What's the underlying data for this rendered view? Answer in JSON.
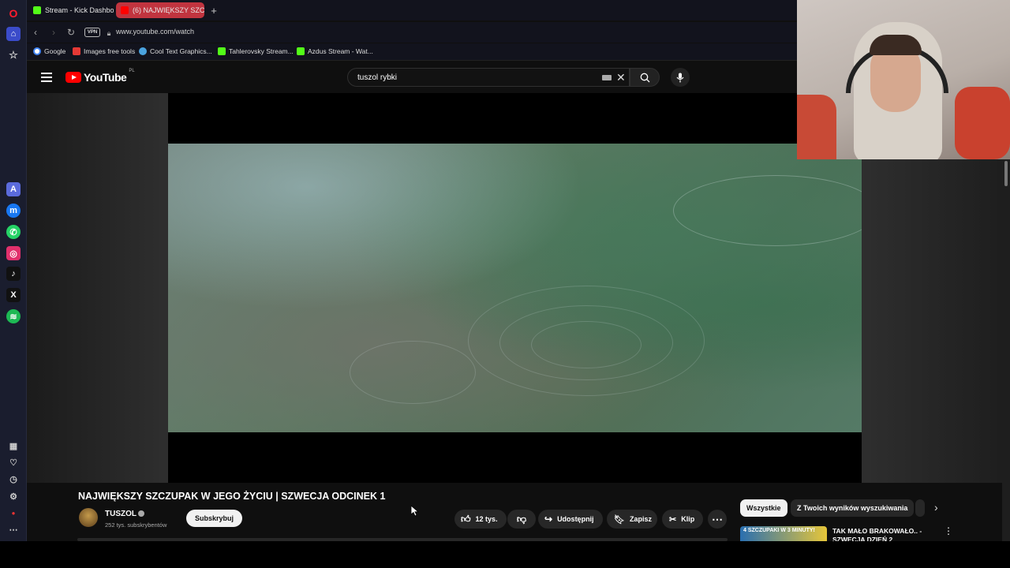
{
  "browser": {
    "tabs": [
      {
        "label": "Stream - Kick Dashboard",
        "favicon_color": "#53fc18",
        "active": false
      },
      {
        "label": "(6) NAJWIĘKSZY SZCZ...",
        "favicon_color": "#ff0000",
        "active": true
      }
    ],
    "address": {
      "vpn": "VPN",
      "url": "www.youtube.com/watch"
    },
    "bookmarks": [
      {
        "label": "Google",
        "color": "#4285f4"
      },
      {
        "label": "Images free tools",
        "color": "#e53935"
      },
      {
        "label": "Cool Text Graphics...",
        "color": "#4aa3df"
      },
      {
        "label": "Tahlerovsky Stream...",
        "color": "#53fc18"
      },
      {
        "label": "Azdus Stream - Wat...",
        "color": "#53fc18"
      }
    ]
  },
  "youtube": {
    "logo": "YouTube",
    "country": "PL",
    "search_value": "tuszol rybki"
  },
  "video": {
    "title": "NAJWIĘKSZY SZCZUPAK W JEGO ŻYCIU | SZWECJA ODCINEK 1",
    "channel": "TUSZOL",
    "subscribers": "252 tys. subskrybentów",
    "subscribe_label": "Subskrybuj",
    "likes": "12 tys.",
    "share_label": "Udostępnij",
    "save_label": "Zapisz",
    "clip_label": "Klip"
  },
  "recommendations": {
    "chips": [
      "Wszystkie",
      "Z Twoich wyników wyszukiwania"
    ],
    "items": [
      {
        "thumb_text": "4 SZCZUPAKI W 3 MINUTY!",
        "title": "TAK MAŁO BRAKOWAŁO.. - SZWECJA DZIEŃ 2"
      }
    ]
  },
  "colors": {
    "accent": "#ff0000",
    "background": "#0f0f0f",
    "pill": "#272727"
  }
}
